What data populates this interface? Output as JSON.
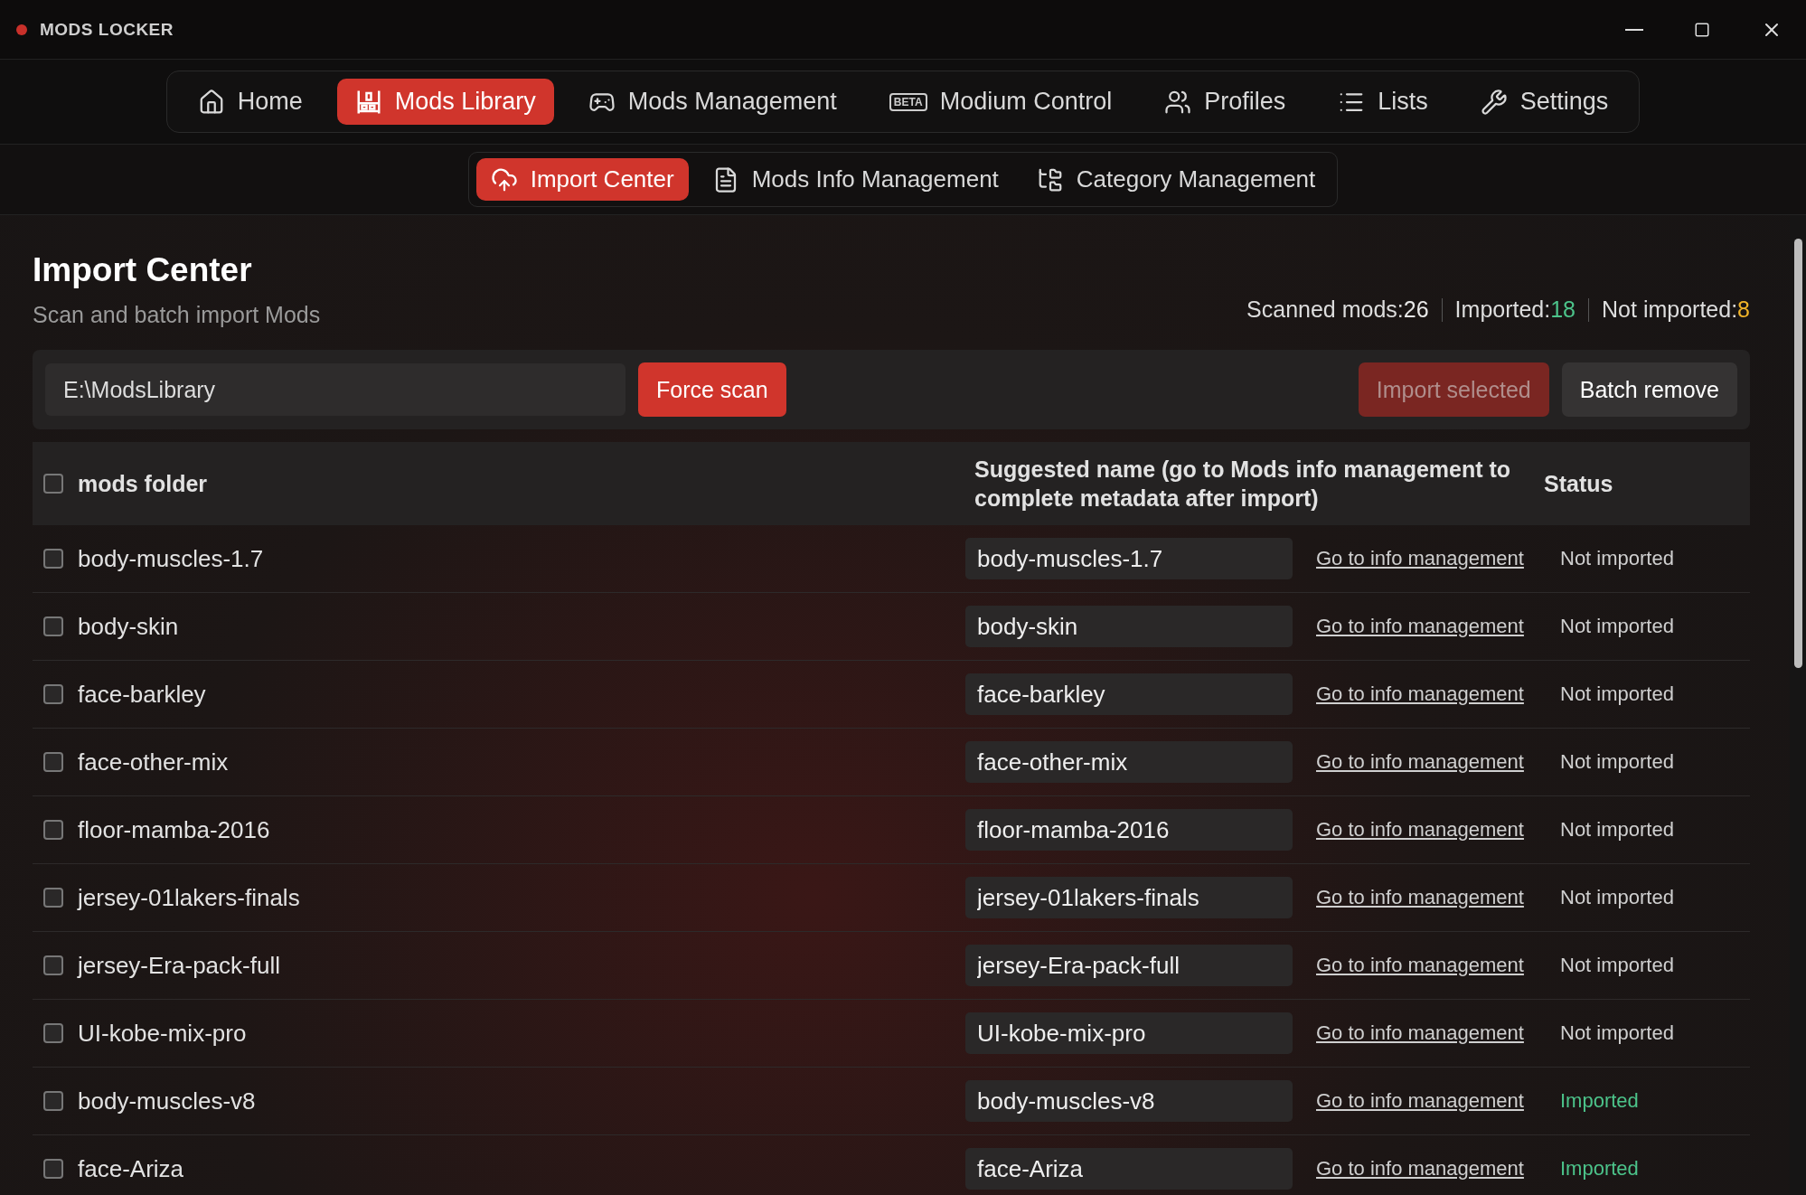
{
  "window": {
    "title": "MODS LOCKER"
  },
  "nav": [
    {
      "label": "Home",
      "selected": false
    },
    {
      "label": "Mods Library",
      "selected": true
    },
    {
      "label": "Mods Management",
      "selected": false
    },
    {
      "label": "Modium Control",
      "badge": "BETA",
      "selected": false
    },
    {
      "label": "Profiles",
      "selected": false
    },
    {
      "label": "Lists",
      "selected": false
    },
    {
      "label": "Settings",
      "selected": false
    }
  ],
  "subnav": [
    {
      "label": "Import Center",
      "selected": true
    },
    {
      "label": "Mods Info Management",
      "selected": false
    },
    {
      "label": "Category Management",
      "selected": false
    }
  ],
  "page": {
    "title": "Import Center",
    "subtitle": "Scan and batch import Mods"
  },
  "stats": [
    {
      "label": "Scanned mods:",
      "value": "26",
      "color": "#e8e8e8"
    },
    {
      "label": "Imported:",
      "value": "18",
      "color": "#4cc38a"
    },
    {
      "label": "Not imported:",
      "value": "8",
      "color": "#f0b429"
    }
  ],
  "toolbar": {
    "path": "E:\\ModsLibrary",
    "scan_button": "Force scan",
    "import_button": {
      "label": "Import selected",
      "disabled": true
    },
    "remove_button": "Batch remove"
  },
  "table": {
    "columns": [
      "mods folder",
      "Suggested name (go to Mods info management to complete metadata after import)",
      "Status"
    ],
    "all_checked": false,
    "rows": [
      {
        "folder": "body-muscles-1.7",
        "name": "body-muscles-1.7",
        "link": "Go to info management",
        "status": "Not imported",
        "imported": false,
        "checked": false
      },
      {
        "folder": "body-skin",
        "name": "body-skin",
        "link": "Go to info management",
        "status": "Not imported",
        "imported": false,
        "checked": false
      },
      {
        "folder": "face-barkley",
        "name": "face-barkley",
        "link": "Go to info management",
        "status": "Not imported",
        "imported": false,
        "checked": false
      },
      {
        "folder": "face-other-mix",
        "name": "face-other-mix",
        "link": "Go to info management",
        "status": "Not imported",
        "imported": false,
        "checked": false
      },
      {
        "folder": "floor-mamba-2016",
        "name": "floor-mamba-2016",
        "link": "Go to info management",
        "status": "Not imported",
        "imported": false,
        "checked": false
      },
      {
        "folder": "jersey-01lakers-finals",
        "name": "jersey-01lakers-finals",
        "link": "Go to info management",
        "status": "Not imported",
        "imported": false,
        "checked": false
      },
      {
        "folder": "jersey-Era-pack-full",
        "name": "jersey-Era-pack-full",
        "link": "Go to info management",
        "status": "Not imported",
        "imported": false,
        "checked": false
      },
      {
        "folder": "UI-kobe-mix-pro",
        "name": "UI-kobe-mix-pro",
        "link": "Go to info management",
        "status": "Not imported",
        "imported": false,
        "checked": false
      },
      {
        "folder": "body-muscles-v8",
        "name": "body-muscles-v8",
        "link": "Go to info management",
        "status": "Imported",
        "imported": true,
        "checked": false
      },
      {
        "folder": "face-Ariza",
        "name": "face-Ariza",
        "link": "Go to info management",
        "status": "Imported",
        "imported": true,
        "checked": false
      }
    ]
  }
}
